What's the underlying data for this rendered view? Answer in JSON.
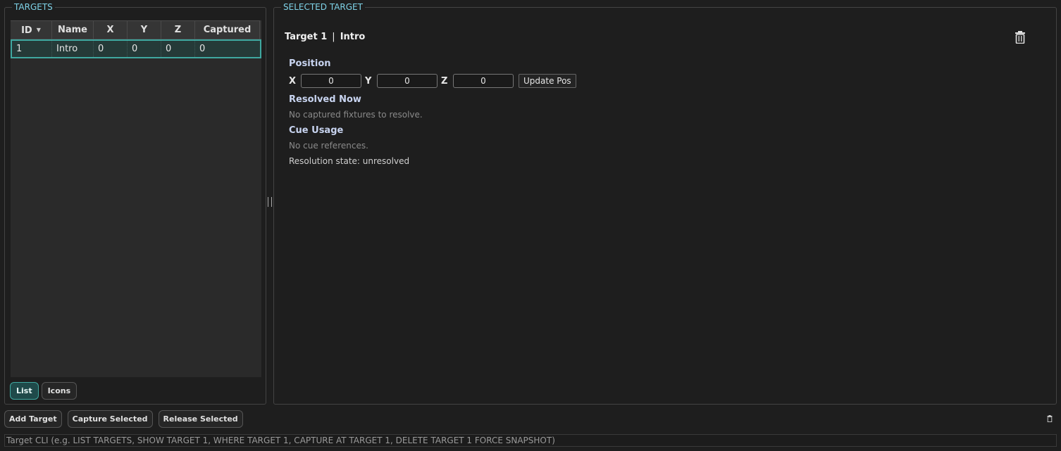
{
  "targets_panel": {
    "title": "TARGETS",
    "columns": [
      "ID",
      "Name",
      "X",
      "Y",
      "Z",
      "Captured"
    ],
    "rows": [
      {
        "id": "1",
        "name": "Intro",
        "x": "0",
        "y": "0",
        "z": "0",
        "captured": "0"
      }
    ],
    "view_buttons": {
      "list": "List",
      "icons": "Icons"
    }
  },
  "selected_panel": {
    "title": "SELECTED TARGET",
    "target_label": "Target 1",
    "separator": "|",
    "target_name": "Intro",
    "position_title": "Position",
    "x_label": "X",
    "y_label": "Y",
    "z_label": "Z",
    "x_value": "0",
    "y_value": "0",
    "z_value": "0",
    "update_button": "Update Pos",
    "resolved_title": "Resolved Now",
    "resolved_text": "No captured fixtures to resolve.",
    "cue_title": "Cue Usage",
    "cue_text": "No cue references.",
    "resolution_state": "Resolution state: unresolved"
  },
  "bottom_bar": {
    "add": "Add Target",
    "capture": "Capture Selected",
    "release": "Release Selected"
  },
  "cli": {
    "placeholder": "Target CLI (e.g. LIST TARGETS, SHOW TARGET 1, WHERE TARGET 1, CAPTURE AT TARGET 1, DELETE TARGET 1 FORCE SNAPSHOT)"
  },
  "colors": {
    "accent": "#3fa8a0",
    "title": "#7fd3e8"
  }
}
